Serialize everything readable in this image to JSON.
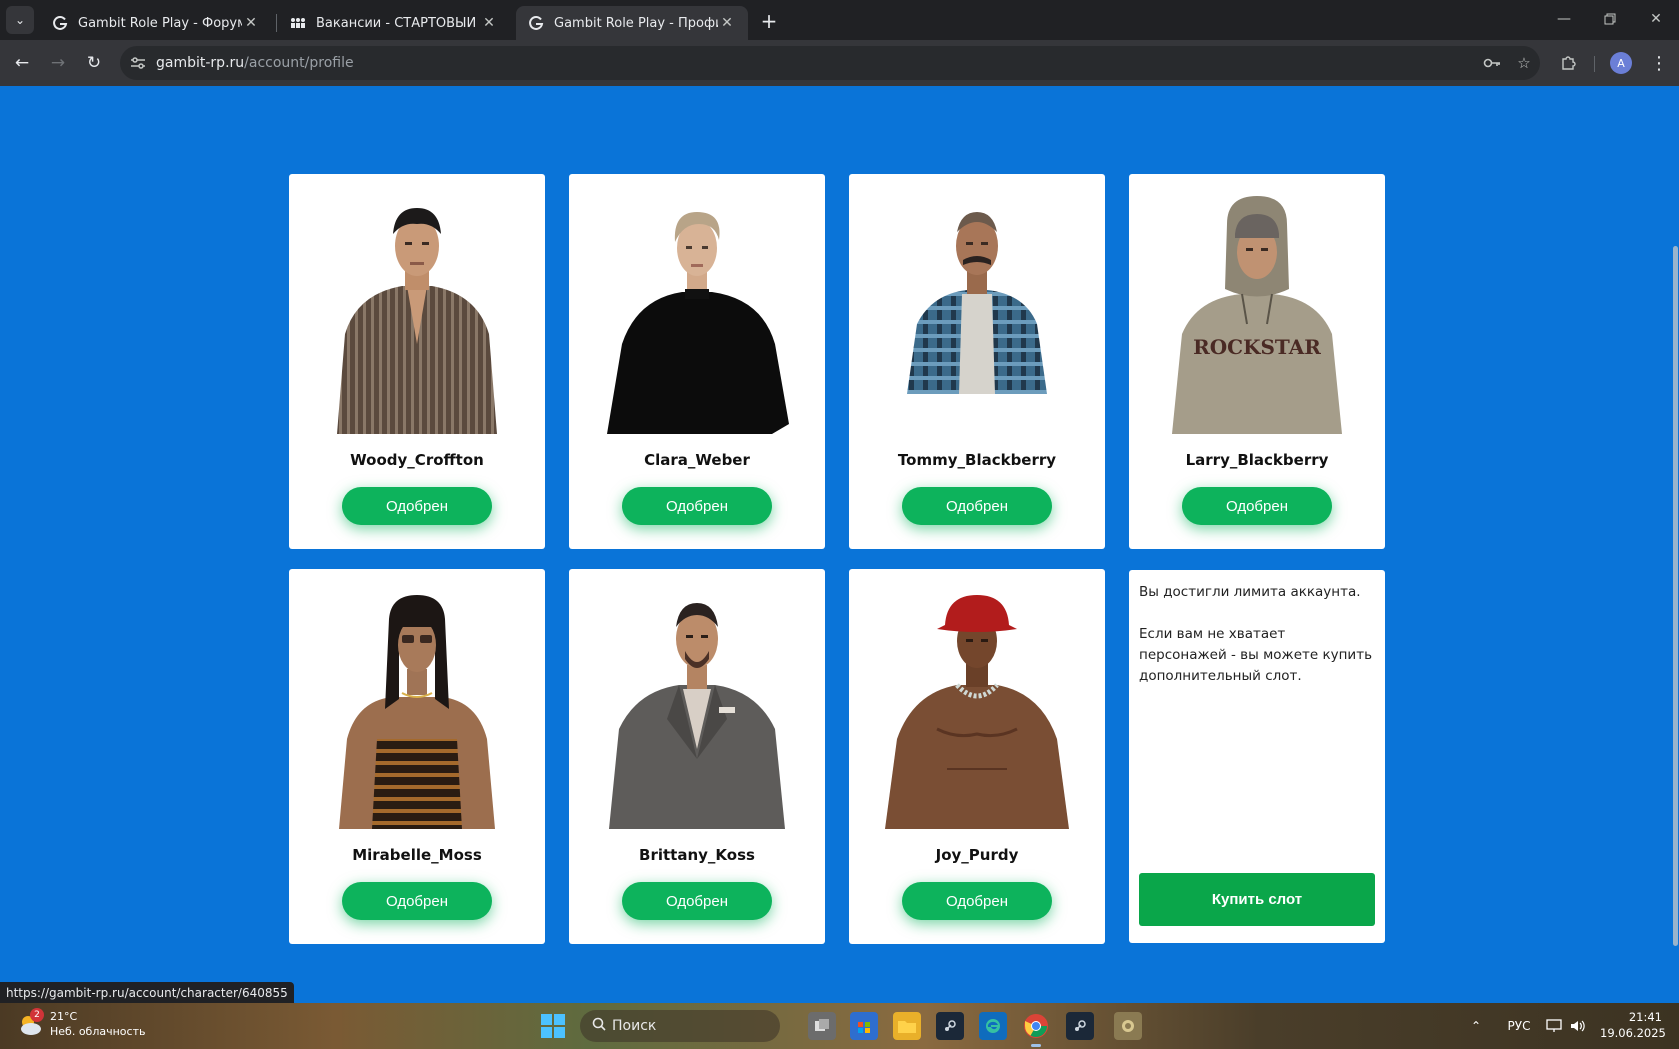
{
  "browser": {
    "tabs": [
      {
        "title": "Gambit Role Play - Форум",
        "active": false
      },
      {
        "title": "Вакансии - СТАРТОВЫЙ СОСТАВ",
        "active": false
      },
      {
        "title": "Gambit Role Play - Профиль UCP",
        "active": true
      }
    ],
    "url_host": "gambit-rp.ru",
    "url_path": "/account/profile",
    "profile_initial": "A"
  },
  "characters": [
    {
      "name": "Woody_Croffton",
      "status": "Одобрен"
    },
    {
      "name": "Clara_Weber",
      "status": "Одобрен"
    },
    {
      "name": "Tommy_Blackberry",
      "status": "Одобрен"
    },
    {
      "name": "Larry_Blackberry",
      "status": "Одобрен"
    },
    {
      "name": "Mirabelle_Moss",
      "status": "Одобрен"
    },
    {
      "name": "Brittany_Koss",
      "status": "Одобрен"
    },
    {
      "name": "Joy_Purdy",
      "status": "Одобрен"
    }
  ],
  "limit_card": {
    "line1": "Вы достигли лимита аккаунта.",
    "line2": "Если вам не хватает персонажей - вы можете купить дополнительный слот.",
    "buy_label": "Купить слот"
  },
  "hood_text": "ROCKSTAR",
  "status_bar_url": "https://gambit-rp.ru/account/character/640855",
  "taskbar": {
    "weather_temp": "21°C",
    "weather_desc": "Неб. облачность",
    "weather_badge": "2",
    "search_placeholder": "Поиск",
    "lang": "РУС",
    "time": "21:41",
    "date": "19.06.2025"
  },
  "colors": {
    "page_bg": "#0a74d8",
    "approved_btn": "#0db35c",
    "buy_btn": "#0aa64a"
  }
}
